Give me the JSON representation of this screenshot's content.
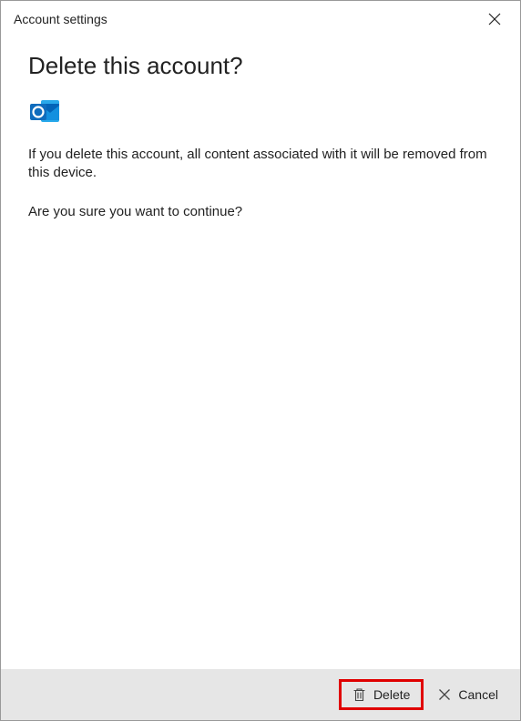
{
  "header": {
    "title": "Account settings"
  },
  "main": {
    "heading": "Delete this account?",
    "warning_text": "If you delete this account, all content associated with it will be removed from this device.",
    "confirm_text": "Are you sure you want to continue?"
  },
  "footer": {
    "delete_label": "Delete",
    "cancel_label": "Cancel"
  }
}
